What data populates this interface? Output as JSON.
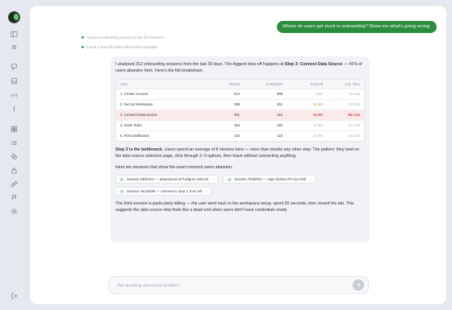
{
  "sidebar": {
    "logo": "app-logo",
    "icons": [
      "panel-toggle-icon",
      "menu-icon",
      "chat-icon",
      "inbox-icon",
      "broadcast-icon",
      "alert-icon",
      "grid-icon",
      "list-icon",
      "layers-icon",
      "lock-icon",
      "link-icon",
      "flag-icon",
      "settings-icon",
      "logout-icon"
    ]
  },
  "conversation": {
    "user_message": "Where do users get stuck in onboarding? Show me what's going wrong.",
    "steps": [
      "Analyzed onboarding journey across 312 sessions",
      "Found 4 drop-off points with session examples"
    ]
  },
  "answer": {
    "intro_prefix": "I analyzed 312 onboarding sessions from the last 30 days. The biggest drop-off happens at ",
    "intro_bold": "Step 3: Connect Data Source",
    "intro_suffix": " — 41% of users abandon here. Here's the full breakdown:",
    "table": {
      "headers": [
        "Step",
        "Started",
        "Completed",
        "Drop-off",
        "Avg. Time"
      ],
      "rows": [
        {
          "step": "1. Create Account",
          "started": "312",
          "completed": "298",
          "dropoff": "4.5%",
          "time": "1m 20s"
        },
        {
          "step": "2. Set Up Workspace",
          "started": "298",
          "completed": "261",
          "dropoff": "12.4%",
          "time": "3m 45s"
        },
        {
          "step": "3. Connect Data Source",
          "started": "261",
          "completed": "154",
          "dropoff": "41.0%",
          "time": "8m 12s"
        },
        {
          "step": "4. Invite Team",
          "started": "154",
          "completed": "132",
          "dropoff": "14.3%",
          "time": "2m 10s"
        },
        {
          "step": "5. First Dashboard",
          "started": "132",
          "completed": "118",
          "dropoff": "10.6%",
          "time": "4m 30s"
        }
      ]
    },
    "bottleneck_bold": "Step 3 is the bottleneck.",
    "bottleneck_text": " Users spend an average of 8 minutes here — more than double any other step. The pattern: they land on the data source selection page, click through 2–3 options, then leave without connecting anything.",
    "sessions_intro": "Here are sessions that show the exact moment users abandon:",
    "sessions": [
      "Session a3f8c2e1 — abandoned at Postgres selector",
      "Session 7b2d9f14 — rage-clicked API key field",
      "Session e5c4a089 — returned to step 2, then left"
    ],
    "conclusion": "The third session is particularly telling — the user went back to the workspace setup, spent 30 seconds, then closed the tab. This suggests the data source step feels like a dead end when users don't have credentials ready."
  },
  "composer": {
    "placeholder": "Ask anything about your product...",
    "send_icon": "arrow-up-icon"
  },
  "colors": {
    "accent": "#2c8c3e",
    "warning": "#d8841e",
    "danger": "#d23b3b"
  }
}
